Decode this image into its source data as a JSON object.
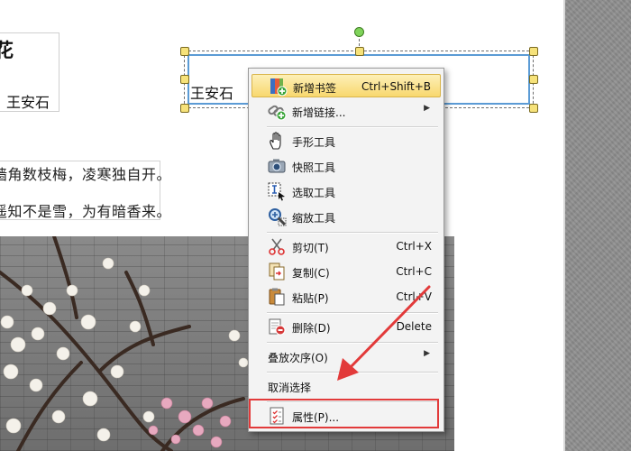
{
  "document": {
    "poem_title": "花",
    "author": "王安石",
    "lines": [
      "墙角数枝梅，凌寒独自开。",
      "遥知不是雪，为有暗香来。"
    ],
    "selected_textbox_text": "王安石"
  },
  "context_menu": {
    "items": [
      {
        "label": "新增书签",
        "shortcut": "Ctrl+Shift+B",
        "icon": "bookmark-add-icon",
        "highlighted": true
      },
      {
        "label": "新增链接...",
        "shortcut": "",
        "icon": "link-add-icon",
        "submenu": true
      },
      {
        "label": "手形工具",
        "shortcut": "",
        "icon": "hand-icon"
      },
      {
        "label": "快照工具",
        "shortcut": "",
        "icon": "camera-icon"
      },
      {
        "label": "选取工具",
        "shortcut": "",
        "icon": "text-select-icon"
      },
      {
        "label": "缩放工具",
        "shortcut": "",
        "icon": "zoom-icon"
      },
      {
        "label": "剪切(T)",
        "shortcut": "Ctrl+X",
        "icon": "scissors-icon"
      },
      {
        "label": "复制(C)",
        "shortcut": "Ctrl+C",
        "icon": "copy-icon"
      },
      {
        "label": "粘贴(P)",
        "shortcut": "Ctrl+V",
        "icon": "paste-icon"
      },
      {
        "label": "删除(D)",
        "shortcut": "Delete",
        "icon": "delete-icon"
      },
      {
        "label": "叠放次序(O)",
        "shortcut": "",
        "submenu": true
      },
      {
        "label": "取消选择",
        "shortcut": ""
      },
      {
        "label": "属性(P)...",
        "shortcut": "",
        "icon": "properties-icon"
      }
    ]
  },
  "colors": {
    "highlight": "#f8d86e",
    "annotation_red": "#e23a3a",
    "selection_blue": "#5b9bd5"
  }
}
